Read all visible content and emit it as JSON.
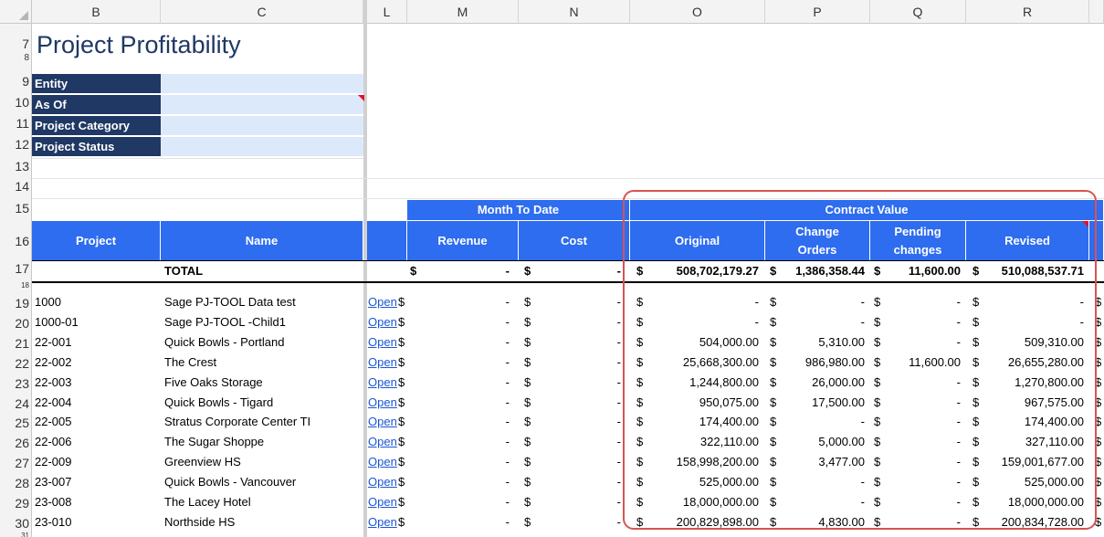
{
  "columns": [
    "B",
    "C",
    "L",
    "M",
    "N",
    "O",
    "P",
    "Q",
    "R"
  ],
  "title": "Project Profitability",
  "filters": [
    {
      "row": "9",
      "label": "Entity",
      "value": ""
    },
    {
      "row": "10",
      "label": "As Of",
      "value": ""
    },
    {
      "row": "11",
      "label": "Project Category",
      "value": ""
    },
    {
      "row": "12",
      "label": "Project Status",
      "value": ""
    }
  ],
  "row_numbers": {
    "r7": "7",
    "r8": "8",
    "r13": "13",
    "r14": "14",
    "r15": "15",
    "r16": "16",
    "r17": "17",
    "r18": "18",
    "r31": "31"
  },
  "group_headers": {
    "mtd": "Month To Date",
    "contract_value": "Contract Value"
  },
  "col_headers": {
    "project": "Project",
    "name": "Name",
    "revenue": "Revenue",
    "cost": "Cost",
    "original": "Original",
    "change_orders_1": "Change",
    "change_orders_2": "Orders",
    "pending_1": "Pending",
    "pending_2": "changes",
    "revised": "Revised"
  },
  "total": {
    "label": "TOTAL",
    "revenue": "-",
    "cost": "-",
    "original": "508,702,179.27",
    "change_orders": "1,386,358.44",
    "pending": "11,600.00",
    "revised": "510,088,537.71"
  },
  "currency": "$",
  "open_label": "Open",
  "rows": [
    {
      "row": "19",
      "project": "1000",
      "name": "Sage PJ-TOOL Data test",
      "revenue": "-",
      "cost": "-",
      "original": "-",
      "change_orders": "-",
      "pending": "-",
      "revised": "-"
    },
    {
      "row": "20",
      "project": "1000-01",
      "name": "Sage PJ-TOOL -Child1",
      "revenue": "-",
      "cost": "-",
      "original": "-",
      "change_orders": "-",
      "pending": "-",
      "revised": "-"
    },
    {
      "row": "21",
      "project": "22-001",
      "name": "Quick Bowls - Portland",
      "revenue": "-",
      "cost": "-",
      "original": "504,000.00",
      "change_orders": "5,310.00",
      "pending": "-",
      "revised": "509,310.00"
    },
    {
      "row": "22",
      "project": "22-002",
      "name": "The Crest",
      "revenue": "-",
      "cost": "-",
      "original": "25,668,300.00",
      "change_orders": "986,980.00",
      "pending": "11,600.00",
      "revised": "26,655,280.00"
    },
    {
      "row": "23",
      "project": "22-003",
      "name": "Five Oaks Storage",
      "revenue": "-",
      "cost": "-",
      "original": "1,244,800.00",
      "change_orders": "26,000.00",
      "pending": "-",
      "revised": "1,270,800.00"
    },
    {
      "row": "24",
      "project": "22-004",
      "name": "Quick Bowls - Tigard",
      "revenue": "-",
      "cost": "-",
      "original": "950,075.00",
      "change_orders": "17,500.00",
      "pending": "-",
      "revised": "967,575.00"
    },
    {
      "row": "25",
      "project": "22-005",
      "name": "Stratus Corporate Center TI",
      "revenue": "-",
      "cost": "-",
      "original": "174,400.00",
      "change_orders": "-",
      "pending": "-",
      "revised": "174,400.00"
    },
    {
      "row": "26",
      "project": "22-006",
      "name": "The Sugar Shoppe",
      "revenue": "-",
      "cost": "-",
      "original": "322,110.00",
      "change_orders": "5,000.00",
      "pending": "-",
      "revised": "327,110.00"
    },
    {
      "row": "27",
      "project": "22-009",
      "name": "Greenview HS",
      "revenue": "-",
      "cost": "-",
      "original": "158,998,200.00",
      "change_orders": "3,477.00",
      "pending": "-",
      "revised": "159,001,677.00"
    },
    {
      "row": "28",
      "project": "23-007",
      "name": "Quick Bowls - Vancouver",
      "revenue": "-",
      "cost": "-",
      "original": "525,000.00",
      "change_orders": "-",
      "pending": "-",
      "revised": "525,000.00"
    },
    {
      "row": "29",
      "project": "23-008",
      "name": "The Lacey Hotel",
      "revenue": "-",
      "cost": "-",
      "original": "18,000,000.00",
      "change_orders": "-",
      "pending": "-",
      "revised": "18,000,000.00"
    },
    {
      "row": "30",
      "project": "23-010",
      "name": "Northside HS",
      "revenue": "-",
      "cost": "-",
      "original": "200,829,898.00",
      "change_orders": "4,830.00",
      "pending": "-",
      "revised": "200,834,728.00"
    }
  ],
  "colors": {
    "navy": "#1f3864",
    "header_blue": "#2e6cf0",
    "input_fill": "#dce9fb",
    "highlight": "#d9534f",
    "link": "#1a56d6"
  }
}
